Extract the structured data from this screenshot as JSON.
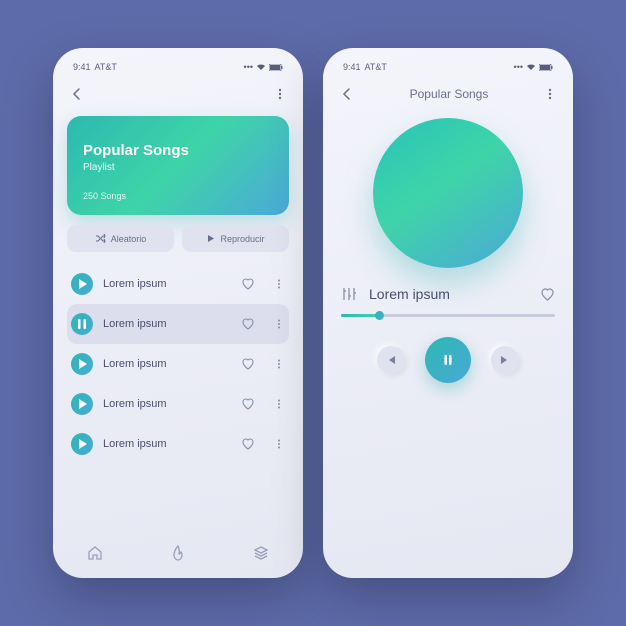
{
  "status": {
    "time": "9:41",
    "carrier": "AT&T"
  },
  "screen1": {
    "hero": {
      "title": "Popular Songs",
      "subtitle": "Playlist",
      "count": "250 Songs"
    },
    "buttons": {
      "shuffle": "Aleatorio",
      "play": "Reproducir"
    },
    "songs": [
      {
        "title": "Lorem ipsum",
        "playing": false
      },
      {
        "title": "Lorem ipsum",
        "playing": true
      },
      {
        "title": "Lorem ipsum",
        "playing": false
      },
      {
        "title": "Lorem ipsum",
        "playing": false
      },
      {
        "title": "Lorem ipsum",
        "playing": false
      }
    ]
  },
  "screen2": {
    "header": "Popular Songs",
    "track": "Lorem ipsum",
    "time_current": "",
    "time_total": ""
  }
}
